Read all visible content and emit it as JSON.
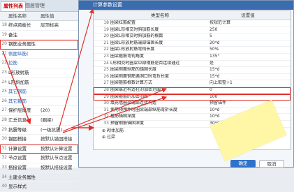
{
  "left_panel": {
    "tabs": [
      "属性列表",
      "图层管理"
    ],
    "headers": [
      "属性名称",
      "属性值"
    ],
    "rows": [
      {
        "n": "18",
        "a": "终点跨板长",
        "b": "层顶标高",
        "blue": false
      },
      {
        "n": "19",
        "a": "备注",
        "b": "",
        "blue": false
      },
      {
        "n": "20",
        "a": "钢筋业务属性",
        "b": "",
        "blue": false,
        "box": true
      },
      {
        "n": "21",
        "a": "侧面纵筋(",
        "b": "",
        "blue": true
      },
      {
        "n": "22",
        "a": "拉筋",
        "b": "",
        "blue": true
      },
      {
        "n": "23",
        "a": "L形放射筋",
        "b": "",
        "blue": false
      },
      {
        "n": "24",
        "a": "L形斜加筋",
        "b": "",
        "blue": false
      },
      {
        "n": "25",
        "a": "其它钢筋",
        "b": "",
        "blue": true
      },
      {
        "n": "26",
        "a": "其它箍筋",
        "b": "",
        "blue": true
      },
      {
        "n": "27",
        "a": "保护层厚度",
        "b": "(20)",
        "blue": false
      },
      {
        "n": "28",
        "a": "汇总信息",
        "b": "(圈梁)",
        "blue": false
      },
      {
        "n": "29",
        "a": "抗震等级",
        "b": "(一级抗震)",
        "blue": false
      },
      {
        "n": "30",
        "a": "锚固搭接",
        "b": "按默认锚固搭接",
        "blue": false
      },
      {
        "n": "31",
        "a": "计算设置",
        "b": "按默认计算设置",
        "blue": false,
        "box": true
      },
      {
        "n": "32",
        "a": "节点设置",
        "b": "按默认节点设置",
        "blue": false
      },
      {
        "n": "33",
        "a": "搭接设置",
        "b": "按默认搭接设置",
        "blue": false
      },
      {
        "n": "34",
        "a": "土建业务属性",
        "b": "",
        "blue": false
      },
      {
        "n": "40",
        "a": "显示样式",
        "b": "",
        "blue": false
      }
    ]
  },
  "dialog": {
    "title": "计算参数设置",
    "headers": [
      "类型名称",
      "设置值"
    ],
    "rows": [
      {
        "n": "18",
        "name": "圈梁拉筋配置",
        "val": "按规范计算"
      },
      {
        "n": "19",
        "name": "圈梁L形相交时斜加筋长度",
        "val": "250"
      },
      {
        "n": "20",
        "name": "圈梁L形相交时斜加筋的根数",
        "val": "5"
      },
      {
        "n": "21",
        "name": "圈梁L形放射筋端部锚固长度",
        "val": "20*d"
      },
      {
        "n": "22",
        "name": "圈梁L形放射筋弯钩长度",
        "val": "50%"
      },
      {
        "n": "23",
        "name": "圈梁箍筋弯钩角度",
        "val": "135°"
      },
      {
        "n": "24",
        "name": "L形相交时圈梁中部钢筋是否连续通过",
        "val": "是"
      },
      {
        "n": "25",
        "name": "圈梁侧面纵筋的锚固长度",
        "val": "15*d"
      },
      {
        "n": "26",
        "name": "圈梁侧面钢筋遇洞口时弯折长度",
        "val": "15*d"
      },
      {
        "n": "27",
        "name": "圈梁箍筋根数计算方式",
        "val": "向上取整+1"
      },
      {
        "n": "28",
        "name": "圈梁靠近构造柱的加密范围",
        "val": "0",
        "box": true
      },
      {
        "n": "29",
        "name": "圈梁箍筋的加密间距",
        "val": "100",
        "box": true
      },
      {
        "n": "30",
        "name": "填充墙圈梁端部连接构造",
        "val": "预留锚件"
      },
      {
        "n": "31",
        "name": "使用预埋件时圈梁端部纵筋弯折长度",
        "val": "10*d"
      },
      {
        "n": "32",
        "name": "植筋锚固深度",
        "val": "10*d"
      },
      {
        "n": "33",
        "name": "预留钢筋锚固深度",
        "val": "30*d"
      }
    ],
    "folded": [
      "砌体加筋",
      "过梁"
    ],
    "ok_label": "确定",
    "cancel_label": "取消"
  },
  "colors": {
    "accent": "#2f73c9",
    "highlight_box": "#e0302a",
    "callout": "#fff7a6"
  }
}
